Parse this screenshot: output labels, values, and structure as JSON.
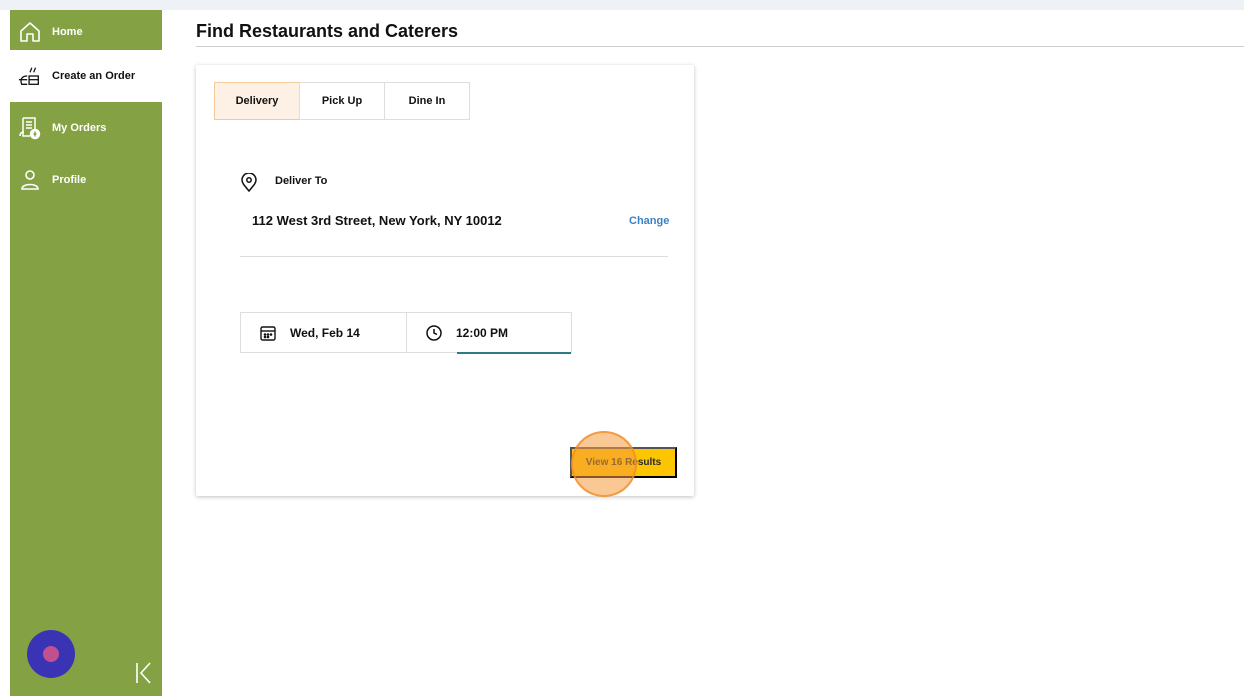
{
  "sidebar": {
    "items": [
      {
        "label": "Home",
        "icon": "home-icon"
      },
      {
        "label": "Create an Order",
        "icon": "create-order-icon"
      },
      {
        "label": "My Orders",
        "icon": "orders-list-icon"
      },
      {
        "label": "Profile",
        "icon": "profile-icon"
      }
    ],
    "active_index": 1,
    "collapse_icon": "collapse-chevron-icon"
  },
  "page": {
    "title": "Find Restaurants and Caterers"
  },
  "order_type": {
    "tabs": [
      "Delivery",
      "Pick Up",
      "Dine In"
    ],
    "selected": "Delivery"
  },
  "delivery": {
    "label": "Deliver To",
    "address": "112 West 3rd Street, New York, NY 10012",
    "change_label": "Change"
  },
  "schedule": {
    "date": "Wed, Feb 14",
    "time": "12:00 PM"
  },
  "actions": {
    "results_button": "View 16 Results"
  },
  "colors": {
    "sidebar": "#84a244",
    "accent_button": "#fdc500",
    "link": "#3a82c4",
    "selected_tab_bg": "#fdf1e6",
    "time_underline": "#2d7b84",
    "fab": "#3a34b5"
  }
}
